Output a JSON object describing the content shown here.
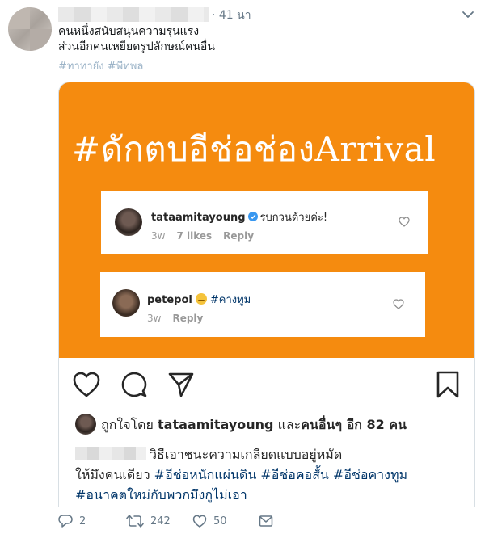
{
  "tweet": {
    "time": "· 41 นา",
    "text_line1": "คนหนึ่งสนับสนุนความรุนแรง",
    "text_line2": "ส่วนอีกคนเหยียดรูปลักษณ์คนอื่น",
    "tags": "#ทาทายัง #พีทพล"
  },
  "media": {
    "headline": "#ดักตบอีช่อช่องArrival",
    "comment1": {
      "user": "tataamitayoung",
      "text": "รบกวนด้วยค่ะ!",
      "time": "3w",
      "likes": "7 likes",
      "reply": "Reply"
    },
    "comment2": {
      "user": "petepol",
      "hashtag": "#คางทูม",
      "time": "3w",
      "reply": "Reply"
    },
    "liked_prefix": "ถูกใจโดย",
    "liked_user": "tataamitayoung",
    "liked_and": "และ",
    "liked_others": "คนอื่นๆ อีก 82 คน",
    "caption_text": "วิธีเอาชนะความเกลียดแบบอยู่หมัด",
    "caption_line2": "ให้มึงคนเดียว",
    "caption_tags": "#อีช่อหนักแผ่นดิน #อีช่อคอสั้น #อีช่อคางทูม #อนาคตใหม่กับพวกมึงกูไม่เอา",
    "orange_color": "#f58b0f"
  },
  "actions": {
    "replies": "2",
    "retweets": "242",
    "likes": "50"
  },
  "icons": [
    "chevron-down-icon",
    "verified-icon",
    "heart-icon",
    "comment-icon",
    "share-icon",
    "bookmark-icon",
    "retweet-icon",
    "mail-icon"
  ]
}
